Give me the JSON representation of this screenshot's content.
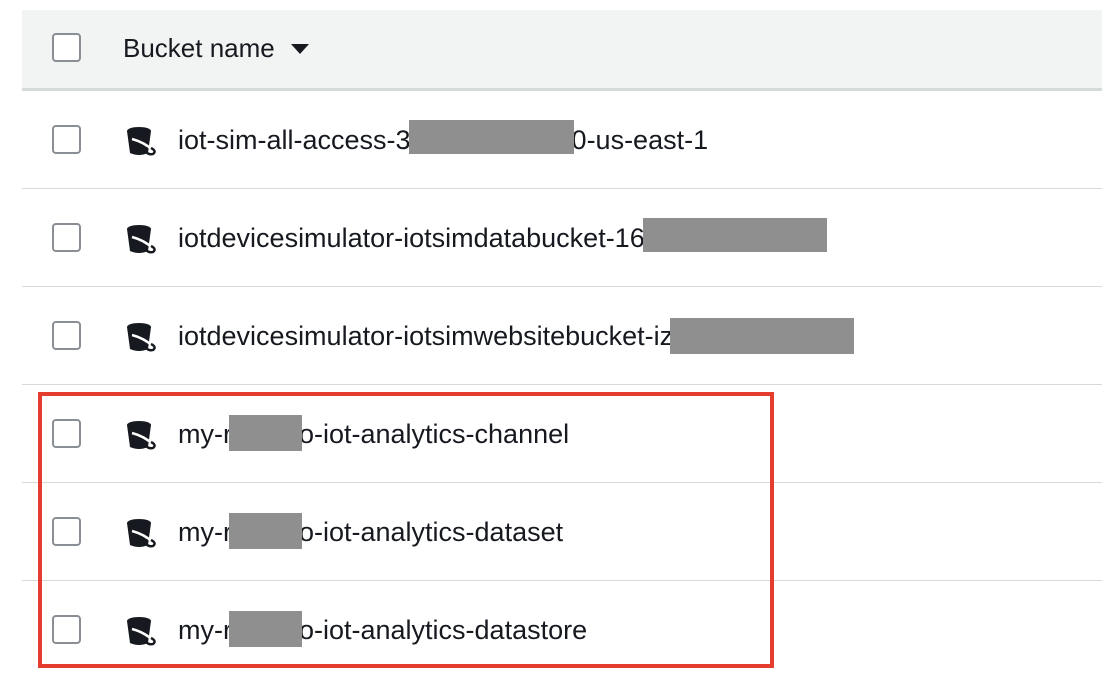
{
  "table": {
    "header": {
      "column_label": "Bucket name",
      "sort_icon": "caret-down-icon"
    },
    "rows": [
      {
        "name_prefix": "iot-sim-all-access-3",
        "name_suffix": "0-us-east-1",
        "icon": "bucket-icon"
      },
      {
        "name_prefix": "iotdevicesimulator-iotsimdatabucket-16",
        "name_suffix": "",
        "icon": "bucket-icon"
      },
      {
        "name_prefix": "iotdevicesimulator-iotsimwebsitebucket-iz",
        "name_suffix": "",
        "icon": "bucket-icon"
      },
      {
        "name_prefix": "my-r",
        "name_suffix": "o-iot-analytics-channel",
        "icon": "bucket-icon"
      },
      {
        "name_prefix": "my-r",
        "name_suffix": "o-iot-analytics-dataset",
        "icon": "bucket-icon"
      },
      {
        "name_prefix": "my-r",
        "name_suffix": "o-iot-analytics-datastore",
        "icon": "bucket-icon"
      }
    ]
  },
  "colors": {
    "highlight": "#e53d2e",
    "redaction": "#8f8f8f",
    "header_bg": "#f2f3f3"
  }
}
